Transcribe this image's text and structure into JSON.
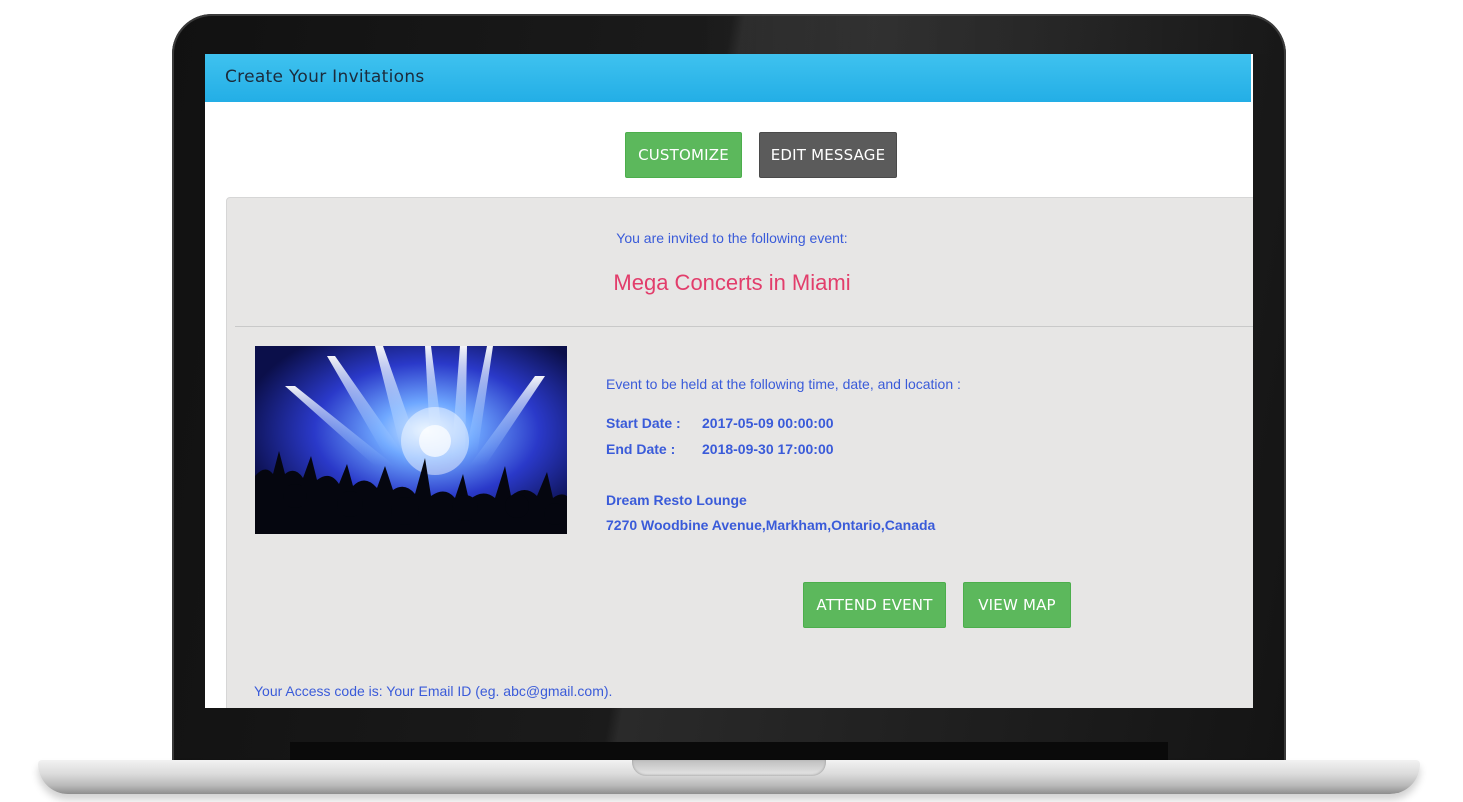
{
  "header": {
    "title": "Create Your Invitations"
  },
  "toolbar": {
    "customize_label": "CUSTOMIZE",
    "edit_message_label": "EDIT MESSAGE"
  },
  "invitation": {
    "intro": "You are invited to the following event:",
    "event_title": "Mega Concerts in Miami",
    "details_intro": "Event to be held at the following time, date, and location :",
    "start_label": "Start Date :",
    "start_value": "2017-05-09 00:00:00",
    "end_label": "End Date :",
    "end_value": "2018-09-30 17:00:00",
    "venue": "Dream Resto Lounge",
    "address": "7270 Woodbine Avenue,Markham,Ontario,Canada",
    "attend_label": "ATTEND EVENT",
    "view_map_label": "VIEW MAP",
    "access_note": "Your Access code is: Your Email ID (eg. abc@gmail.com)."
  },
  "colors": {
    "header_blue": "#2bb5ea",
    "button_green": "#5cb85c",
    "button_gray": "#5b5b5b",
    "title_pink": "#e23d6b",
    "text_blue": "#3a5bd9",
    "panel_bg": "#e7e6e5"
  },
  "icons": {
    "event_image": "concert-crowd-image"
  }
}
